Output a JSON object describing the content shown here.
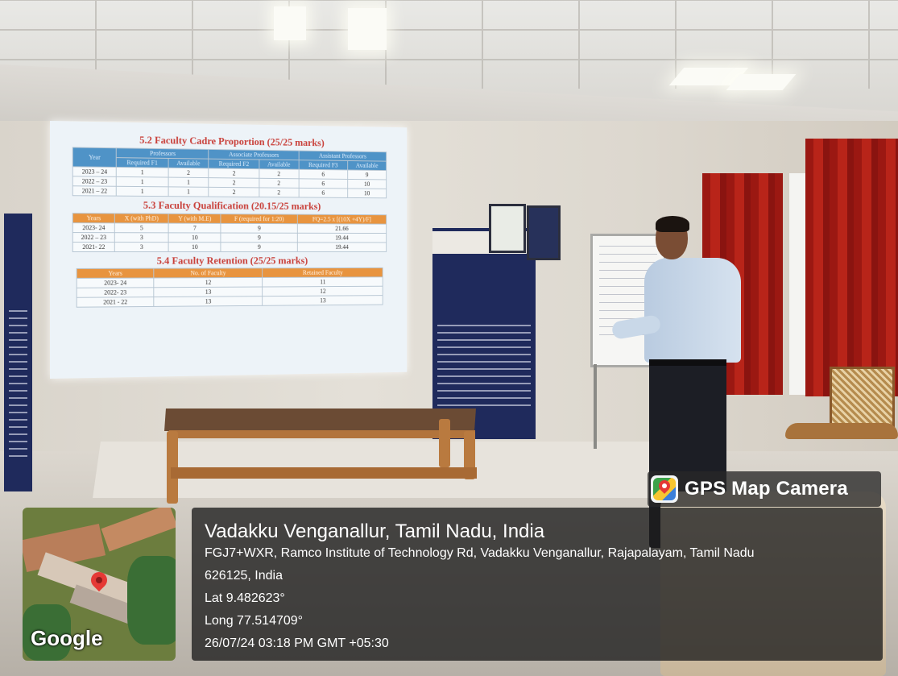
{
  "slide": {
    "title_cadre": "5.2 Faculty Cadre Proportion (25/25 marks)",
    "cadre_headers": [
      "Year",
      "Professors",
      "Associate Professors",
      "Assistant Professors"
    ],
    "cadre_subheaders": [
      "Required F1",
      "Available",
      "Required F2",
      "Available",
      "Required F3",
      "Available"
    ],
    "cadre_rows": [
      [
        "2023 – 24",
        "1",
        "2",
        "2",
        "2",
        "6",
        "9"
      ],
      [
        "2022 – 23",
        "1",
        "1",
        "2",
        "2",
        "6",
        "10"
      ],
      [
        "2021 – 22",
        "1",
        "1",
        "2",
        "2",
        "6",
        "10"
      ]
    ],
    "title_qualification": "5.3 Faculty Qualification (20.15/25 marks)",
    "qual_headers": [
      "Years",
      "X (with PhD)",
      "Y (with M.E)",
      "F (required for 1:20)",
      "FQ=2.5 x [(10X +4Y)/F]"
    ],
    "qual_rows": [
      [
        "2023- 24",
        "5",
        "7",
        "9",
        "21.66"
      ],
      [
        "2022 – 23",
        "3",
        "10",
        "9",
        "19.44"
      ],
      [
        "2021- 22",
        "3",
        "10",
        "9",
        "19.44"
      ]
    ],
    "title_retention": "5.4 Faculty Retention (25/25 marks)",
    "ret_headers": [
      "Years",
      "No. of Faculty",
      "Retained Faculty"
    ],
    "ret_rows": [
      [
        "2023- 24",
        "12",
        "11"
      ],
      [
        "2022- 23",
        "13",
        "12"
      ],
      [
        "2021 - 22",
        "13",
        "13"
      ]
    ]
  },
  "gps": {
    "badge": "GPS Map Camera",
    "map_brand": "Google",
    "location_title": "Vadakku Venganallur, Tamil Nadu, India",
    "address_line1": "FGJ7+WXR, Ramco Institute of Technology Rd, Vadakku Venganallur, Rajapalayam, Tamil Nadu",
    "address_line2": "626125, India",
    "latitude": "Lat 9.482623°",
    "longitude": "Long 77.514709°",
    "timestamp": "26/07/24 03:18 PM GMT +05:30"
  }
}
